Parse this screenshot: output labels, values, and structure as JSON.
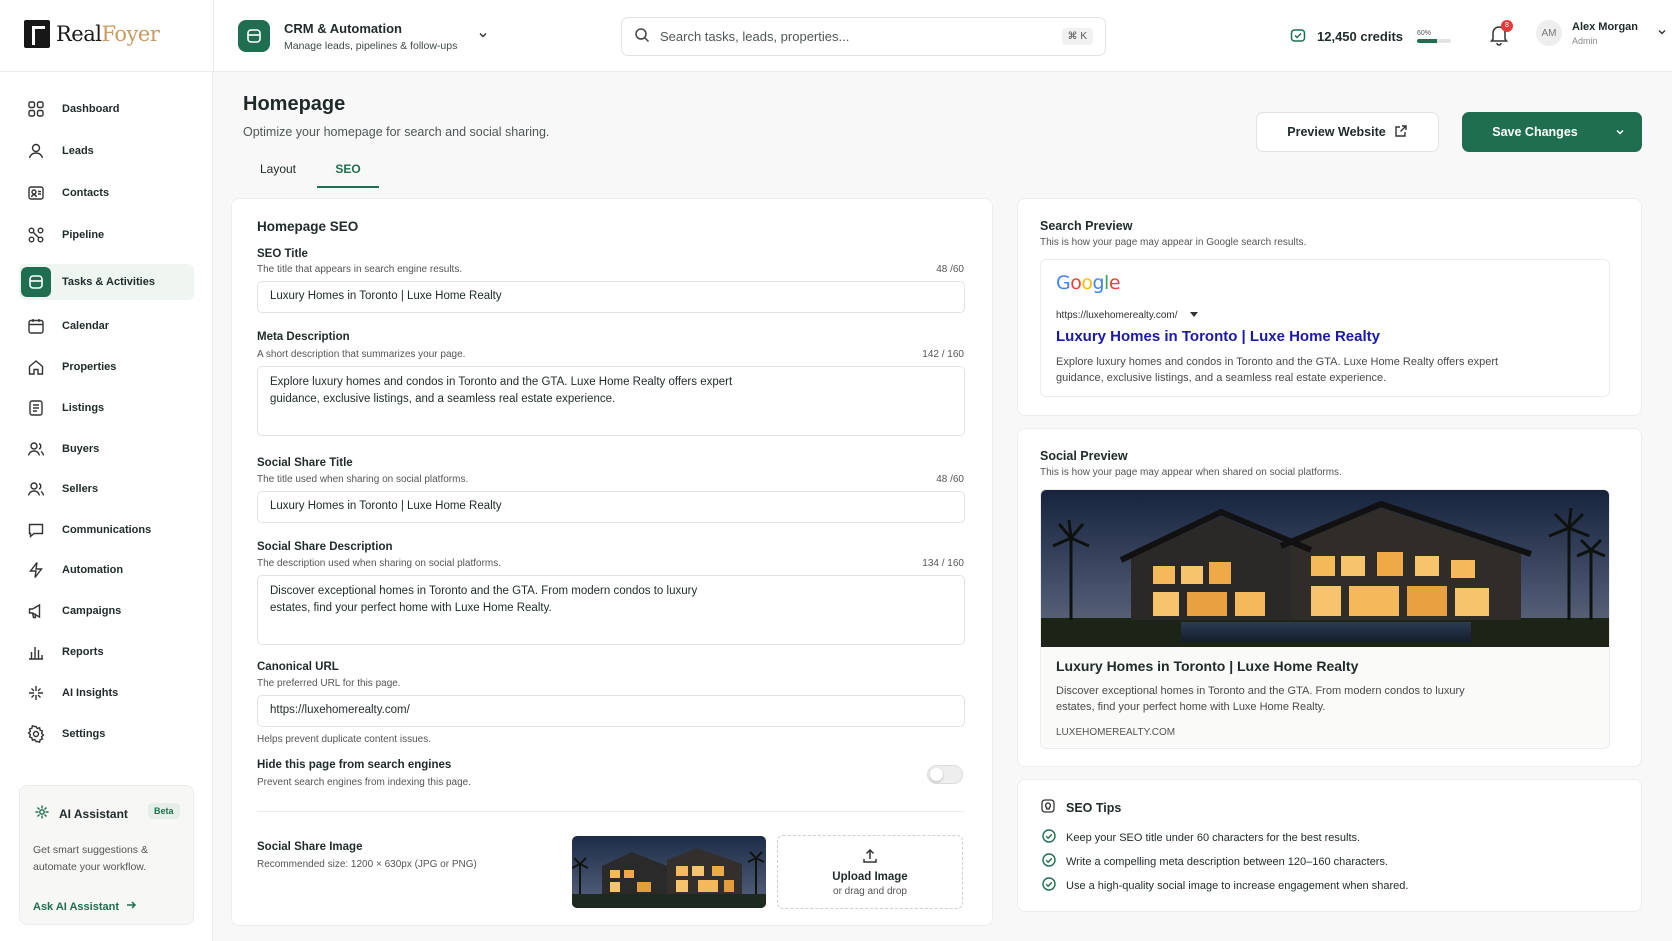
{
  "brand": {
    "name_a": "Real",
    "name_b": "Foyer"
  },
  "module": {
    "title": "CRM & Automation",
    "subtitle": "Manage leads, pipelines & follow-ups"
  },
  "search": {
    "placeholder": "Search tasks, leads, properties...",
    "shortcut": "⌘ K"
  },
  "credits": {
    "label": "12,450 credits",
    "percent_label": "60%",
    "percent": 60
  },
  "notifications": {
    "count": "8"
  },
  "user": {
    "initials": "AM",
    "name": "Alex Morgan",
    "role": "Admin"
  },
  "sidebar": {
    "items": [
      {
        "label": "Dashboard",
        "icon": "dashboard-icon"
      },
      {
        "label": "Leads",
        "icon": "user-icon"
      },
      {
        "label": "Contacts",
        "icon": "contact-card-icon"
      },
      {
        "label": "Pipeline",
        "icon": "pipeline-icon"
      },
      {
        "label": "Tasks & Activities",
        "icon": "tasks-icon",
        "active": true
      },
      {
        "label": "Calendar",
        "icon": "calendar-icon"
      },
      {
        "label": "Properties",
        "icon": "home-icon"
      },
      {
        "label": "Listings",
        "icon": "listings-icon"
      },
      {
        "label": "Buyers",
        "icon": "buyers-icon"
      },
      {
        "label": "Sellers",
        "icon": "sellers-icon"
      },
      {
        "label": "Communications",
        "icon": "chat-icon"
      },
      {
        "label": "Automation",
        "icon": "bolt-icon"
      },
      {
        "label": "Campaigns",
        "icon": "megaphone-icon"
      },
      {
        "label": "Reports",
        "icon": "bar-chart-icon"
      },
      {
        "label": "AI Insights",
        "icon": "sparkle-icon"
      },
      {
        "label": "Settings",
        "icon": "gear-icon"
      }
    ],
    "ai_card": {
      "title": "AI Assistant",
      "badge": "Beta",
      "text": "Get smart suggestions & automate your workflow.",
      "link": "Ask AI Assistant"
    }
  },
  "page": {
    "title": "Homepage",
    "subtitle": "Optimize your homepage for search and social sharing.",
    "tabs": [
      "Layout",
      "SEO"
    ],
    "active_tab": "SEO",
    "preview_button": "Preview Website",
    "save_button": "Save Changes"
  },
  "form": {
    "title": "Homepage SEO",
    "seo_title": {
      "label": "SEO Title",
      "help": "The title that appears in search engine results.",
      "count": "48 /60",
      "value": "Luxury Homes in Toronto | Luxe Home Realty"
    },
    "meta_description": {
      "label": "Meta Description",
      "help": "A short description that summarizes your page.",
      "count": "142 / 160",
      "value": "Explore luxury homes and condos in Toronto and the GTA. Luxe Home Realty offers expert guidance, exclusive listings, and a seamless real estate experience."
    },
    "social_title": {
      "label": "Social Share Title",
      "help": "The title used when sharing on social platforms.",
      "count": "48 /60",
      "value": "Luxury Homes in Toronto | Luxe Home Realty"
    },
    "social_description": {
      "label": "Social Share Description",
      "help": "The description used when sharing on social platforms.",
      "count": "134 / 160",
      "value": "Discover exceptional homes in Toronto and the GTA. From modern condos to luxury estates, find your perfect home with Luxe Home Realty."
    },
    "canonical": {
      "label": "Canonical URL",
      "help": "The preferred URL for this page.",
      "value": "https://luxehomerealty.com/",
      "note": "Helps prevent duplicate content issues."
    },
    "hide": {
      "label": "Hide this page from search engines",
      "help": "Prevent search engines from indexing this page.",
      "enabled": false
    },
    "share_image": {
      "label": "Social Share Image",
      "help": "Recommended size: 1200 × 630px (JPG or PNG)",
      "upload_title": "Upload Image",
      "upload_sub": "or drag and drop"
    }
  },
  "search_preview": {
    "title": "Search Preview",
    "subtitle": "This is how your page may appear in Google search results.",
    "google": "Google",
    "url": "https://luxehomerealty.com/",
    "result_title": "Luxury Homes in Toronto | Luxe Home Realty",
    "result_desc": "Explore luxury homes and condos in Toronto and the GTA. Luxe Home Realty offers expert guidance, exclusive listings, and a seamless real estate experience."
  },
  "social_preview": {
    "title": "Social Preview",
    "subtitle": "This is how your page may appear when shared on social platforms.",
    "card_title": "Luxury Homes in Toronto | Luxe Home Realty",
    "card_desc": "Discover exceptional homes in Toronto and the GTA. From modern condos to luxury estates, find your perfect home with Luxe Home Realty.",
    "domain": "LUXEHOMEREALTY.COM"
  },
  "seo_tips": {
    "title": "SEO Tips",
    "items": [
      "Keep your SEO title under 60 characters for the best results.",
      "Write a compelling meta description between 120–160 characters.",
      "Use a high-quality social image to increase engagement when shared."
    ]
  },
  "colors": {
    "accent": "#1e6e4f",
    "brand_gold": "#c99a61",
    "link": "#1a1aa6"
  }
}
